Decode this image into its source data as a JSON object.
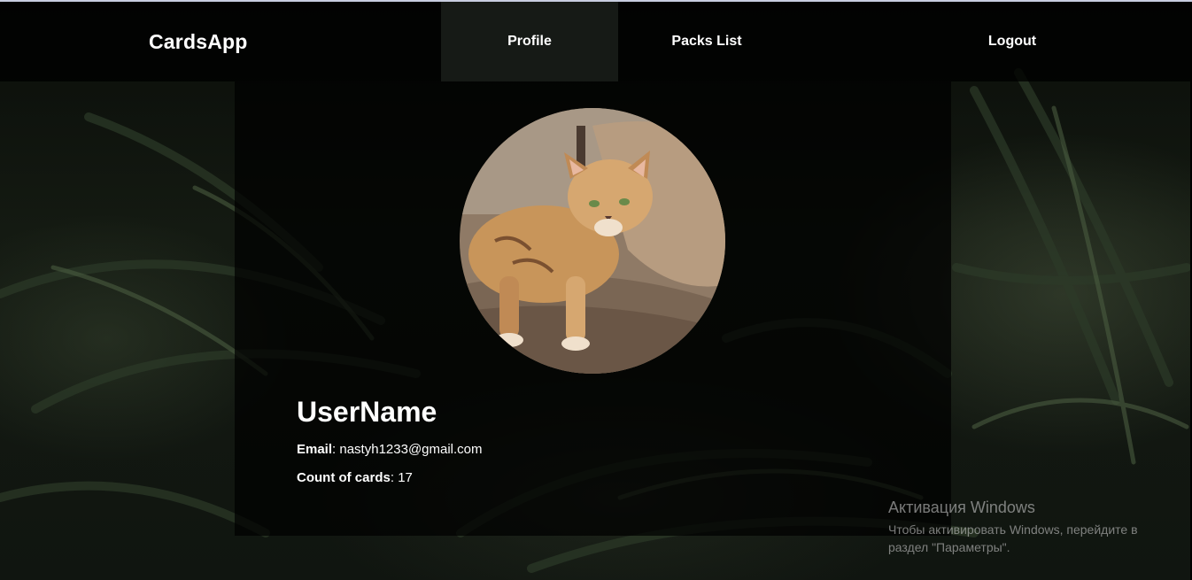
{
  "header": {
    "brand": "CardsApp",
    "nav": {
      "profile": "Profile",
      "packs": "Packs List",
      "logout": "Logout"
    }
  },
  "profile": {
    "username": "UserName",
    "email_label": "Email",
    "email": "nastyh1233@gmail.com",
    "count_label": "Count of cards",
    "count": "17",
    "avatar": "cat-photo"
  },
  "watermark": {
    "title": "Активация Windows",
    "text": "Чтобы активировать Windows, перейдите в раздел \"Параметры\"."
  }
}
